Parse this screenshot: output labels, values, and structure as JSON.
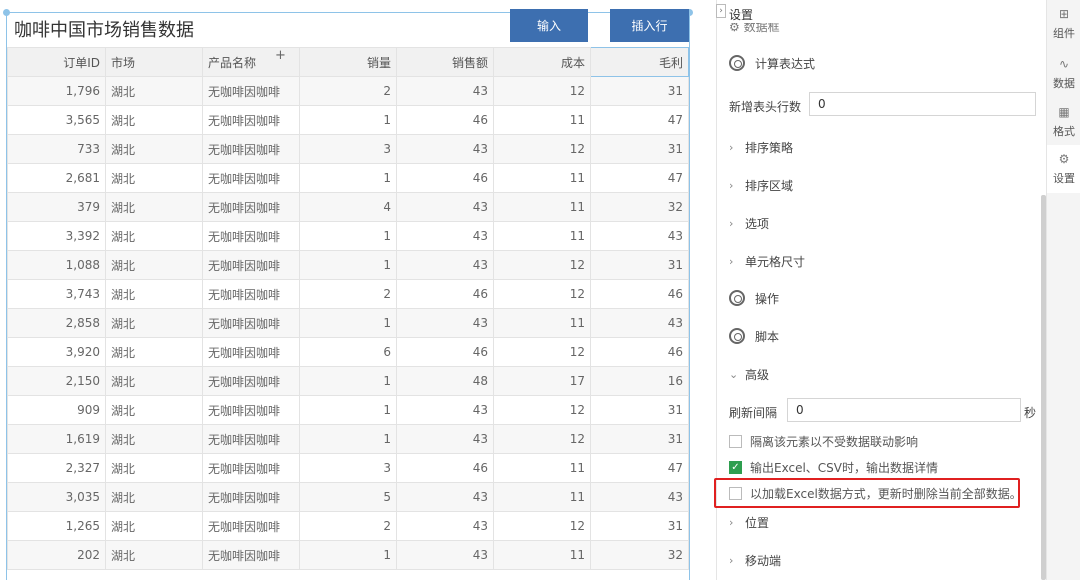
{
  "table": {
    "title": "咖啡中国市场销售数据",
    "buttons": {
      "input": "输入",
      "insert_row": "插入行"
    },
    "headers": [
      "订单ID",
      "市场",
      "产品名称",
      "销量",
      "销售额",
      "成本",
      "毛利"
    ],
    "add_column_glyph": "+",
    "rows": [
      [
        "1,796",
        "湖北",
        "无咖啡因咖啡",
        "2",
        "43",
        "12",
        "31"
      ],
      [
        "3,565",
        "湖北",
        "无咖啡因咖啡",
        "1",
        "46",
        "11",
        "47"
      ],
      [
        "733",
        "湖北",
        "无咖啡因咖啡",
        "3",
        "43",
        "12",
        "31"
      ],
      [
        "2,681",
        "湖北",
        "无咖啡因咖啡",
        "1",
        "46",
        "11",
        "47"
      ],
      [
        "379",
        "湖北",
        "无咖啡因咖啡",
        "4",
        "43",
        "11",
        "32"
      ],
      [
        "3,392",
        "湖北",
        "无咖啡因咖啡",
        "1",
        "43",
        "11",
        "43"
      ],
      [
        "1,088",
        "湖北",
        "无咖啡因咖啡",
        "1",
        "43",
        "12",
        "31"
      ],
      [
        "3,743",
        "湖北",
        "无咖啡因咖啡",
        "2",
        "46",
        "12",
        "46"
      ],
      [
        "2,858",
        "湖北",
        "无咖啡因咖啡",
        "1",
        "43",
        "11",
        "43"
      ],
      [
        "3,920",
        "湖北",
        "无咖啡因咖啡",
        "6",
        "46",
        "12",
        "46"
      ],
      [
        "2,150",
        "湖北",
        "无咖啡因咖啡",
        "1",
        "48",
        "17",
        "16"
      ],
      [
        "909",
        "湖北",
        "无咖啡因咖啡",
        "1",
        "43",
        "12",
        "31"
      ],
      [
        "1,619",
        "湖北",
        "无咖啡因咖啡",
        "1",
        "43",
        "12",
        "31"
      ],
      [
        "2,327",
        "湖北",
        "无咖啡因咖啡",
        "3",
        "46",
        "11",
        "47"
      ],
      [
        "3,035",
        "湖北",
        "无咖啡因咖啡",
        "5",
        "43",
        "11",
        "43"
      ],
      [
        "1,265",
        "湖北",
        "无咖啡因咖啡",
        "2",
        "43",
        "12",
        "31"
      ],
      [
        "202",
        "湖北",
        "无咖啡因咖啡",
        "1",
        "43",
        "11",
        "32"
      ]
    ]
  },
  "panel": {
    "title": "设置",
    "partial_item": "数据框",
    "calc_expression": "计算表达式",
    "header_rows_label": "新增表头行数",
    "header_rows_value": "0",
    "sort_strategy": "排序策略",
    "sort_area": "排序区域",
    "options": "选项",
    "cell_size": "单元格尺寸",
    "operation": "操作",
    "script": "脚本",
    "advanced": "高级",
    "refresh_label": "刷新间隔",
    "refresh_value": "0",
    "refresh_unit": "秒",
    "chk_isolate": "隔离该元素以不受数据联动影响",
    "chk_export": "输出Excel、CSV时，输出数据详情",
    "chk_load_excel": "以加载Excel数据方式，更新时删除当前全部数据。",
    "position": "位置",
    "mobile": "移动端"
  },
  "tabs": [
    {
      "label": "组件",
      "icon": "component-icon"
    },
    {
      "label": "数据",
      "icon": "data-icon"
    },
    {
      "label": "格式",
      "icon": "format-icon"
    },
    {
      "label": "设置",
      "icon": "settings-icon"
    }
  ],
  "colors": {
    "button": "#3d6fb0",
    "checked": "#2e9e4f",
    "highlight": "#e02020",
    "selection": "#8ec3e8"
  }
}
